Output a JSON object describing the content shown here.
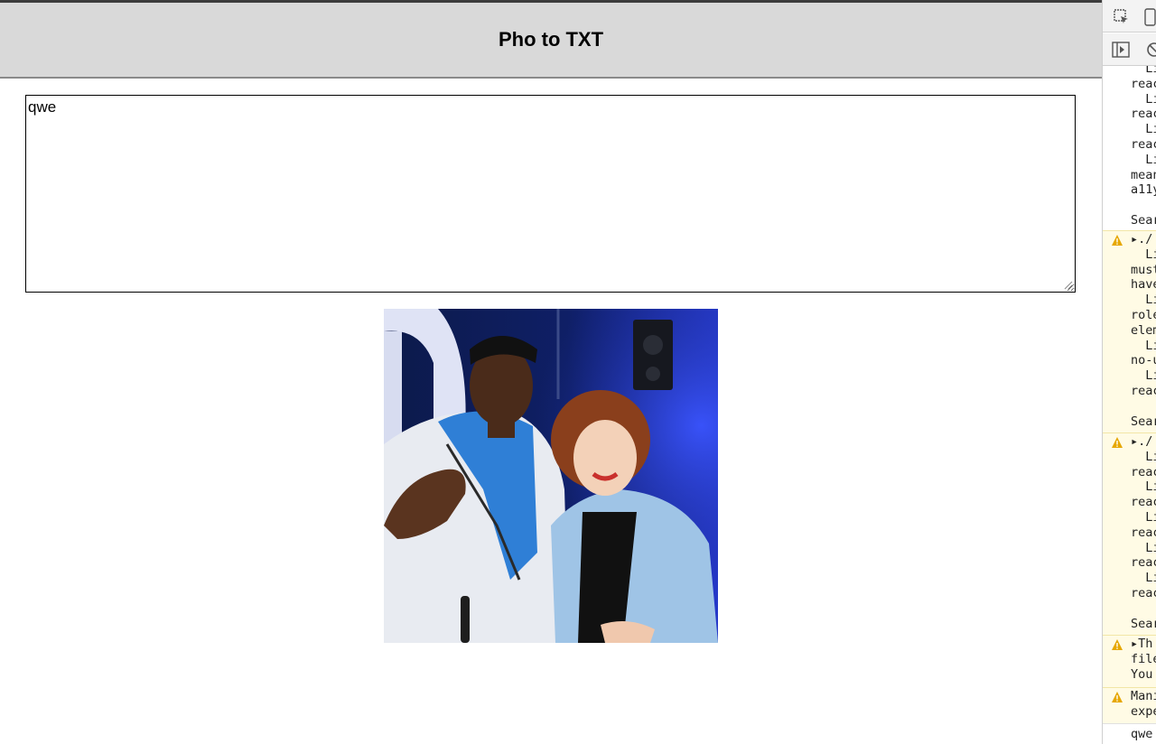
{
  "page": {
    "title": "Pho to TXT",
    "textarea_value": "qwe"
  },
  "photo": {
    "alt_icon": "photo-image"
  },
  "devtools": {
    "toolbar_icons": [
      "inspect-element-icon",
      "device-toolbar-icon",
      "sidebar-toggle-icon",
      "clear-console-icon"
    ],
    "log_lines_top": [
      "  Li",
      "reac",
      "  Li",
      "reac",
      "  Li",
      "reac",
      "  Li",
      "mean",
      "a11y",
      "",
      "Sear"
    ],
    "warn_blocks": [
      {
        "lines": [
          "▸./",
          "  Li",
          "must",
          "have",
          "  Li",
          "role",
          "elem",
          "  Li",
          "no-u",
          "  Li",
          "reac",
          "",
          "Sear"
        ]
      },
      {
        "lines": [
          "▸./",
          "  Li",
          "reac",
          "  Li",
          "reac",
          "  Li",
          "reac",
          "  Li",
          "reac",
          "  Li",
          "reac",
          "",
          "Sear"
        ]
      },
      {
        "lines": [
          "▸Th",
          "file",
          "You"
        ]
      },
      {
        "lines": [
          "Mani",
          "expe"
        ]
      }
    ],
    "last_log": "qwe"
  },
  "colors": {
    "header_bg": "#d9d9d9",
    "warn_bg": "#fffbe5",
    "warn_icon": "#e6a700"
  }
}
